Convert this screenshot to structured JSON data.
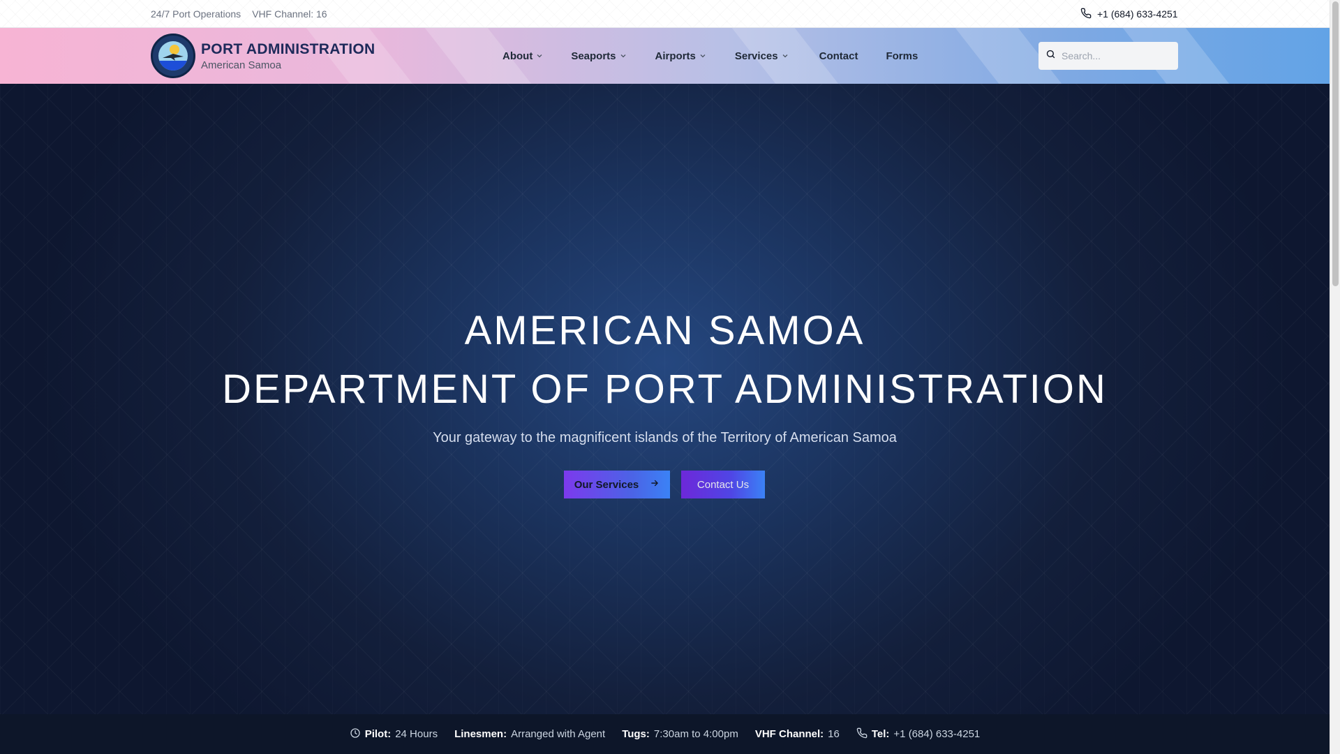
{
  "topbar": {
    "operations": "24/7 Port Operations",
    "vhf": "VHF Channel: 16",
    "phone": "+1 (684) 633-4251"
  },
  "brand": {
    "title": "PORT ADMINISTRATION",
    "subtitle": "American Samoa"
  },
  "nav": {
    "items": [
      {
        "label": "About",
        "dropdown": true
      },
      {
        "label": "Seaports",
        "dropdown": true
      },
      {
        "label": "Airports",
        "dropdown": true
      },
      {
        "label": "Services",
        "dropdown": true
      },
      {
        "label": "Contact",
        "dropdown": false
      },
      {
        "label": "Forms",
        "dropdown": false
      }
    ]
  },
  "search": {
    "placeholder": "Search...",
    "value": ""
  },
  "hero": {
    "line1": "AMERICAN SAMOA",
    "line2": "DEPARTMENT OF PORT ADMINISTRATION",
    "subtitle": "Your gateway to the magnificent islands of the Territory of American Samoa",
    "primary_cta": "Our Services",
    "secondary_cta": "Contact Us"
  },
  "info": {
    "pilot_label": "Pilot:",
    "pilot_value": "24 Hours",
    "linesmen_label": "Linesmen:",
    "linesmen_value": "Arranged with Agent",
    "tugs_label": "Tugs:",
    "tugs_value": "7:30am to 4:00pm",
    "vhf_label": "VHF Channel:",
    "vhf_value": "16",
    "tel_label": "Tel:",
    "tel_value": "+1 (684) 633-4251"
  },
  "colors": {
    "accent_purple": "#7c3aed",
    "accent_blue": "#3b82f6",
    "hero_dark": "#0e1730",
    "brand_text": "#1e2a5a"
  }
}
